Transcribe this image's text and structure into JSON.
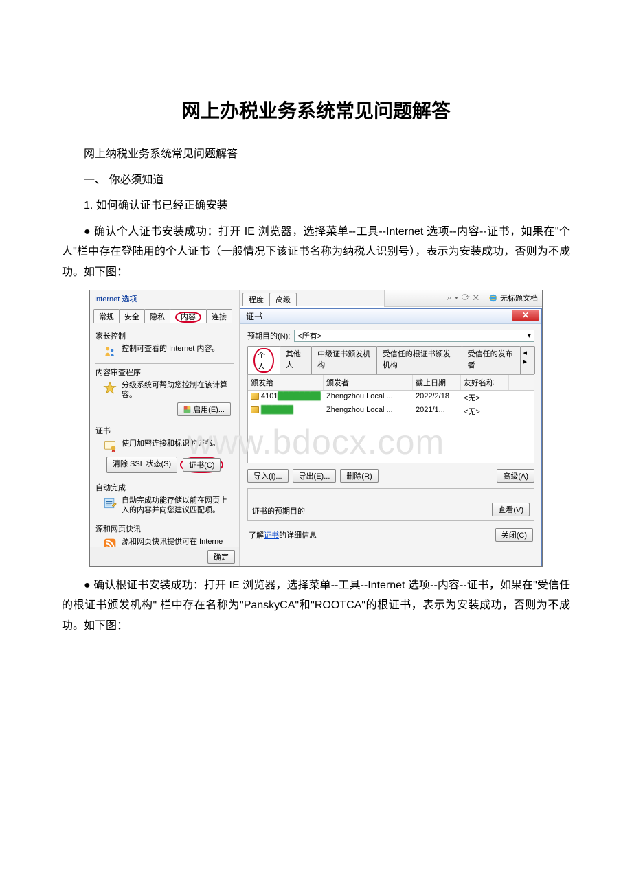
{
  "document": {
    "title": "网上办税业务系统常见问题解答",
    "para1": "网上纳税业务系统常见问题解答",
    "sec1": "一、 你必须知道",
    "item1": "1. 如何确认证书已经正确安装",
    "bullet1": "● 确认个人证书安装成功：打开 IE 浏览器，选择菜单--工具--Internet 选项--内容--证书，如果在\"个人\"栏中存在登陆用的个人证书（一般情况下该证书名称为纳税人识别号），表示为安装成功，否则为不成功。如下图：",
    "bullet2": "● 确认根证书安装成功：打开 IE 浏览器，选择菜单--工具--Internet 选项--内容--证书，如果在\"受信任的根证书颁发机构\" 栏中存在名称为\"PanskyCA\"和\"ROOTCA\"的根证书，表示为安装成功，否则为不成功。如下图：",
    "watermark": "www.bdocx.com"
  },
  "ie_options": {
    "window_title": "Internet 选项",
    "tabs": [
      "常规",
      "安全",
      "隐私",
      "内容",
      "连接",
      "程序",
      "高级"
    ],
    "parental": {
      "header": "家长控制",
      "text": "控制可查看的 Internet 内容。"
    },
    "content_advisor": {
      "header": "内容审查程序",
      "text": "分级系统可帮助您控制在该计算\n容。",
      "enable_btn": "启用(E)..."
    },
    "certificates": {
      "header": "证书",
      "text": "使用加密连接和标识的证书。",
      "clear_ssl": "清除 SSL 状态(S)",
      "cert_btn": "证书(C)"
    },
    "autocomplete": {
      "header": "自动完成",
      "text": "自动完成功能存储以前在网页上\n入的内容并向您建议匹配项。"
    },
    "feeds": {
      "header": "源和网页快讯",
      "text": "源和网页快讯提供可在 Interne\nExplorer 和其他程序中读取的\n更新内容。"
    },
    "ok_btn": "确定"
  },
  "browser": {
    "address_icons": "⌕ ▾  ⟳ ✕",
    "dummy_tabs": [
      "程度",
      "高级"
    ],
    "tab_title": "无标题文档"
  },
  "cert_dialog": {
    "title": "证书",
    "purpose_label": "预期目的(N):",
    "purpose_value": "<所有>",
    "tabs": [
      "个人",
      "其他人",
      "中级证书颁发机构",
      "受信任的根证书颁发机构",
      "受信任的发布者"
    ],
    "columns": [
      "颁发给",
      "颁发者",
      "截止日期",
      "友好名称"
    ],
    "rows": [
      {
        "issued_to": "4101",
        "issuer": "Zhengzhou Local ...",
        "expires": "2022/2/18",
        "friendly": "<无>"
      },
      {
        "issued_to": "",
        "issuer": "Zhengzhou Local ...",
        "expires": "2021/1...",
        "friendly": "<无>"
      }
    ],
    "import_btn": "导入(I)...",
    "export_btn": "导出(E)...",
    "remove_btn": "删除(R)",
    "advanced_btn": "高级(A)",
    "purpose_box": "证书的预期目的",
    "view_btn": "查看(V)",
    "learn_prefix": "了解",
    "learn_link": "证书",
    "learn_suffix": "的详细信息",
    "close_btn": "关闭(C)"
  }
}
